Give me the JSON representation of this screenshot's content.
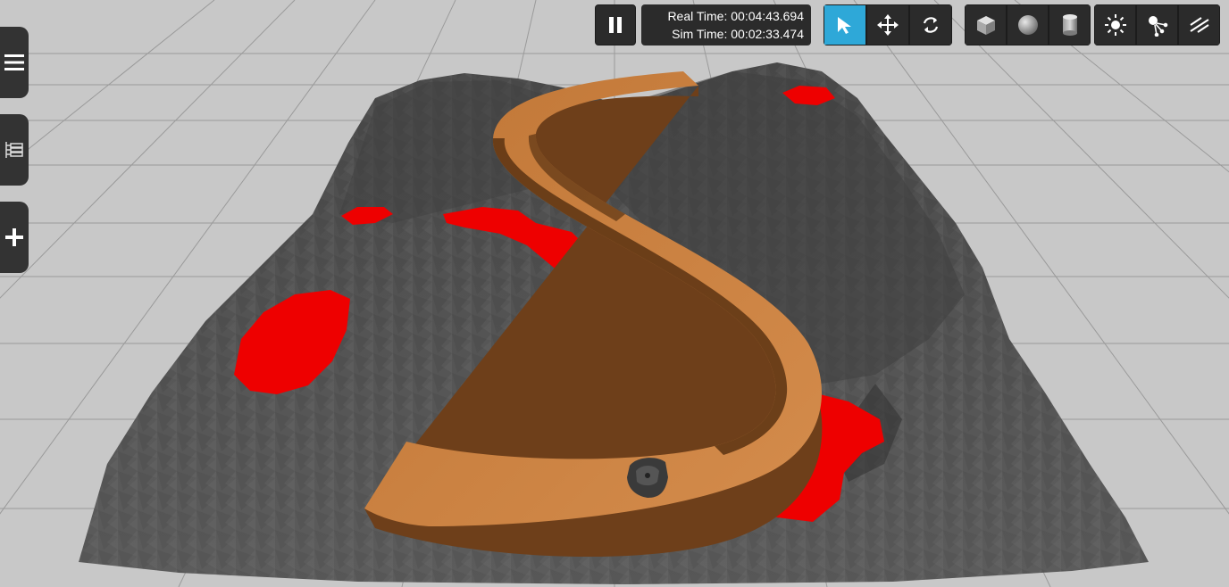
{
  "toolbar": {
    "real_time_label": "Real Time:",
    "real_time_value": "00:04:43.694",
    "sim_time_label": "Sim Time:",
    "sim_time_value": "00:02:33.474",
    "active_tool": "select"
  },
  "icons": {
    "pause": "pause-icon",
    "select": "arrow-pointer-icon",
    "translate": "move-arrows-icon",
    "rotate": "rotate-icon",
    "box": "box-icon",
    "sphere": "sphere-icon",
    "cylinder": "cylinder-icon",
    "point_light": "sun-icon",
    "spot_light": "spot-light-icon",
    "directional_light": "directional-light-icon",
    "menu": "hamburger-icon",
    "tree": "tree-icon",
    "insert": "plus-icon"
  },
  "colors": {
    "sky": "#c8c8c8",
    "grid": "#9a9a9a",
    "terrain": "#5a5a5a",
    "lava": "#ee0000",
    "track": "#c87a3a",
    "toolbar": "#2b2b2b",
    "accent": "#2ea8d8"
  }
}
